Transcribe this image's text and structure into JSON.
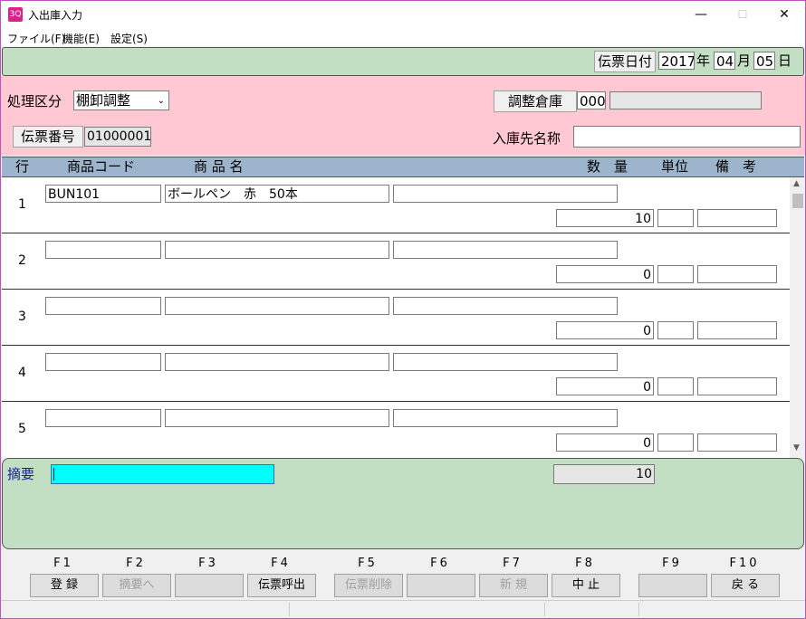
{
  "window": {
    "app_icon": "3Q",
    "title": "入出庫入力",
    "minimize": "—",
    "maximize": "☐",
    "close": "✕"
  },
  "menu": [
    "ファイル(F)",
    "機能(E)",
    "設定(S)"
  ],
  "date": {
    "label": "伝票日付",
    "year": "2017",
    "year_unit": "年",
    "month": "04",
    "month_unit": "月",
    "day": "05",
    "day_unit": "日"
  },
  "header_form": {
    "category_label": "処理区分",
    "category_value": "棚卸調整",
    "warehouse_label": "調整倉庫",
    "warehouse_code": "000",
    "warehouse_name": "",
    "slip_label": "伝票番号",
    "slip_value": "01000001",
    "dest_label": "入庫先名称",
    "dest_value": ""
  },
  "columns": {
    "row": "行",
    "code": "商品コード",
    "name": "商 品 名",
    "qty": "数　量",
    "unit": "単位",
    "note": "備　考"
  },
  "rows": [
    {
      "num": "1",
      "code": "BUN101",
      "name": "ボールペン　赤　50本",
      "spec": "",
      "qty": "10",
      "unit": "",
      "note": ""
    },
    {
      "num": "2",
      "code": "",
      "name": "",
      "spec": "",
      "qty": "0",
      "unit": "",
      "note": ""
    },
    {
      "num": "3",
      "code": "",
      "name": "",
      "spec": "",
      "qty": "0",
      "unit": "",
      "note": ""
    },
    {
      "num": "4",
      "code": "",
      "name": "",
      "spec": "",
      "qty": "0",
      "unit": "",
      "note": ""
    },
    {
      "num": "5",
      "code": "",
      "name": "",
      "spec": "",
      "qty": "0",
      "unit": "",
      "note": ""
    }
  ],
  "summary": {
    "label": "摘要",
    "value": "",
    "total": "10"
  },
  "fkeys": [
    {
      "key": "F1",
      "label": "登 録",
      "enabled": true
    },
    {
      "key": "F2",
      "label": "摘要へ",
      "enabled": false
    },
    {
      "key": "F3",
      "label": "",
      "enabled": false
    },
    {
      "key": "F4",
      "label": "伝票呼出",
      "enabled": true
    },
    {
      "key": "F5",
      "label": "伝票削除",
      "enabled": false
    },
    {
      "key": "F6",
      "label": "",
      "enabled": false
    },
    {
      "key": "F7",
      "label": "新 規",
      "enabled": false
    },
    {
      "key": "F8",
      "label": "中 止",
      "enabled": true
    },
    {
      "key": "F9",
      "label": "",
      "enabled": false
    },
    {
      "key": "F10",
      "label": "戻 る",
      "enabled": true
    }
  ],
  "colors": {
    "green_band": "#c3dfc3",
    "pink_band": "#ffc8d2",
    "header_blue": "#9cb4cc",
    "active_field": "#00ffff"
  }
}
